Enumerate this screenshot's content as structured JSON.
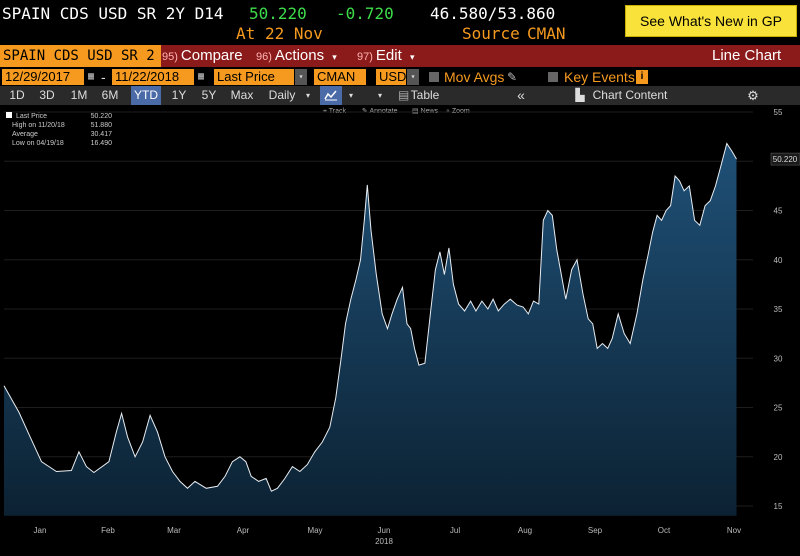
{
  "header": {
    "security": "SPAIN CDS USD SR 2Y D14",
    "last_price": "50.220",
    "change": "-0.720",
    "range": "46.580/53.860",
    "at_label": "At",
    "at_date": "22 Nov",
    "source_label": "Source",
    "source": "CMAN",
    "gp_banner": "See What's New in GP"
  },
  "menu": {
    "security_field": "SPAIN CDS USD SR 2",
    "compare_num": "95)",
    "compare": "Compare",
    "actions_num": "96)",
    "actions": "Actions",
    "edit_num": "97)",
    "edit": "Edit",
    "chart_type": "Line Chart"
  },
  "params": {
    "start_date": "12/29/2017",
    "dash": "-",
    "end_date": "11/22/2018",
    "field": "Last Price",
    "source": "CMAN",
    "currency": "USD",
    "mov_avgs": "Mov Avgs",
    "key_events": "Key Events"
  },
  "rangebar": {
    "buttons": [
      "1D",
      "3D",
      "1M",
      "6M",
      "YTD",
      "1Y",
      "5Y",
      "Max"
    ],
    "active": "YTD",
    "period": "Daily",
    "table": "Table",
    "chart_content": "Chart Content"
  },
  "toolbar": {
    "track": "Track",
    "annotate": "Annotate",
    "news": "News",
    "zoom": "Zoom"
  },
  "legend": {
    "last_price_label": "Last Price",
    "last_price_value": "50.220",
    "high_label": "High on 11/20/18",
    "high_value": "51.880",
    "avg_label": "Average",
    "avg_value": "30.417",
    "low_label": "Low on 04/19/18",
    "low_value": "16.490"
  },
  "colors": {
    "background": "#000000",
    "line": "#e8edf2",
    "fill_top": "#1d4a6b",
    "fill_bottom": "#0c2233",
    "accent_orange": "#f59a1f",
    "menu_red": "#8b1a1a",
    "positive_green": "#3ddc4a",
    "banner_yellow": "#f9e33a"
  },
  "chart_data": {
    "type": "area",
    "title": "",
    "xlabel": "2018",
    "ylabel": "",
    "ylim": [
      14,
      55
    ],
    "yticks": [
      15,
      20,
      25,
      30,
      35,
      40,
      45,
      50,
      55
    ],
    "months": [
      "Jan",
      "Feb",
      "Mar",
      "Apr",
      "May",
      "Jun",
      "Jul",
      "Aug",
      "Sep",
      "Oct",
      "Nov"
    ],
    "year_label": "2018",
    "last_value_label": "50.220",
    "series": [
      {
        "values": [
          [
            0.0,
            27.2
          ],
          [
            2.0,
            24.5
          ],
          [
            3.5,
            22.0
          ],
          [
            5.0,
            19.5
          ],
          [
            7.0,
            18.5
          ],
          [
            9.0,
            18.6
          ],
          [
            10.0,
            20.5
          ],
          [
            11.0,
            19.0
          ],
          [
            12.0,
            18.4
          ],
          [
            14.0,
            19.5
          ],
          [
            15.0,
            22.5
          ],
          [
            15.7,
            24.4
          ],
          [
            16.5,
            22.0
          ],
          [
            17.5,
            20.0
          ],
          [
            18.5,
            21.5
          ],
          [
            19.5,
            24.2
          ],
          [
            20.5,
            22.5
          ],
          [
            21.5,
            20.0
          ],
          [
            22.5,
            18.5
          ],
          [
            23.5,
            17.5
          ],
          [
            24.5,
            16.8
          ],
          [
            25.5,
            17.5
          ],
          [
            27.0,
            16.8
          ],
          [
            28.5,
            17.0
          ],
          [
            29.5,
            18.0
          ],
          [
            30.5,
            19.5
          ],
          [
            31.5,
            20.0
          ],
          [
            32.3,
            19.5
          ],
          [
            33.0,
            18.0
          ],
          [
            34.0,
            17.5
          ],
          [
            35.0,
            17.8
          ],
          [
            35.7,
            16.5
          ],
          [
            36.5,
            16.8
          ],
          [
            37.5,
            17.8
          ],
          [
            38.5,
            19.0
          ],
          [
            39.5,
            18.5
          ],
          [
            40.5,
            19.2
          ],
          [
            41.5,
            20.5
          ],
          [
            42.5,
            21.5
          ],
          [
            43.5,
            23.0
          ],
          [
            44.3,
            26.0
          ],
          [
            45.0,
            30.0
          ],
          [
            45.6,
            33.5
          ],
          [
            46.3,
            36.0
          ],
          [
            47.0,
            38.0
          ],
          [
            47.6,
            40.0
          ],
          [
            48.1,
            44.0
          ],
          [
            48.5,
            47.6
          ],
          [
            49.0,
            43.0
          ],
          [
            49.7,
            38.5
          ],
          [
            50.5,
            34.5
          ],
          [
            51.2,
            33.0
          ],
          [
            51.8,
            34.5
          ],
          [
            52.5,
            36.0
          ],
          [
            53.2,
            37.2
          ],
          [
            53.8,
            33.5
          ],
          [
            54.3,
            33.0
          ],
          [
            54.8,
            31.0
          ],
          [
            55.4,
            29.3
          ],
          [
            56.2,
            29.5
          ],
          [
            57.0,
            35.0
          ],
          [
            57.6,
            39.0
          ],
          [
            58.2,
            40.8
          ],
          [
            58.8,
            38.5
          ],
          [
            59.4,
            41.2
          ],
          [
            60.0,
            37.5
          ],
          [
            60.7,
            35.5
          ],
          [
            61.5,
            34.8
          ],
          [
            62.3,
            35.8
          ],
          [
            63.0,
            34.8
          ],
          [
            63.8,
            35.8
          ],
          [
            64.6,
            35.0
          ],
          [
            65.3,
            36.0
          ],
          [
            66.0,
            34.8
          ],
          [
            66.8,
            35.5
          ],
          [
            67.6,
            36.0
          ],
          [
            68.5,
            35.4
          ],
          [
            69.3,
            35.2
          ],
          [
            70.0,
            34.5
          ],
          [
            70.7,
            35.8
          ],
          [
            71.4,
            35.5
          ],
          [
            72.0,
            44.0
          ],
          [
            72.6,
            45.0
          ],
          [
            73.2,
            44.5
          ],
          [
            73.8,
            41.0
          ],
          [
            74.4,
            38.5
          ],
          [
            75.0,
            36.0
          ],
          [
            75.8,
            39.0
          ],
          [
            76.5,
            40.0
          ],
          [
            77.3,
            36.5
          ],
          [
            78.0,
            34.0
          ],
          [
            78.6,
            33.5
          ],
          [
            79.2,
            31.0
          ],
          [
            79.9,
            31.5
          ],
          [
            80.6,
            31.0
          ],
          [
            81.2,
            32.0
          ],
          [
            82.0,
            34.5
          ],
          [
            82.8,
            32.5
          ],
          [
            83.6,
            31.5
          ],
          [
            84.5,
            34.5
          ],
          [
            85.3,
            38.0
          ],
          [
            86.0,
            40.5
          ],
          [
            86.6,
            42.8
          ],
          [
            87.2,
            44.5
          ],
          [
            87.8,
            44.0
          ],
          [
            88.4,
            45.0
          ],
          [
            89.0,
            45.5
          ],
          [
            89.6,
            48.5
          ],
          [
            90.2,
            48.0
          ],
          [
            90.8,
            47.0
          ],
          [
            91.5,
            47.5
          ],
          [
            92.2,
            44.0
          ],
          [
            92.9,
            43.5
          ],
          [
            93.6,
            45.5
          ],
          [
            94.3,
            46.0
          ],
          [
            95.0,
            47.5
          ],
          [
            95.7,
            49.5
          ],
          [
            96.5,
            51.8
          ],
          [
            97.2,
            51.0
          ],
          [
            97.8,
            50.22
          ]
        ]
      }
    ]
  }
}
